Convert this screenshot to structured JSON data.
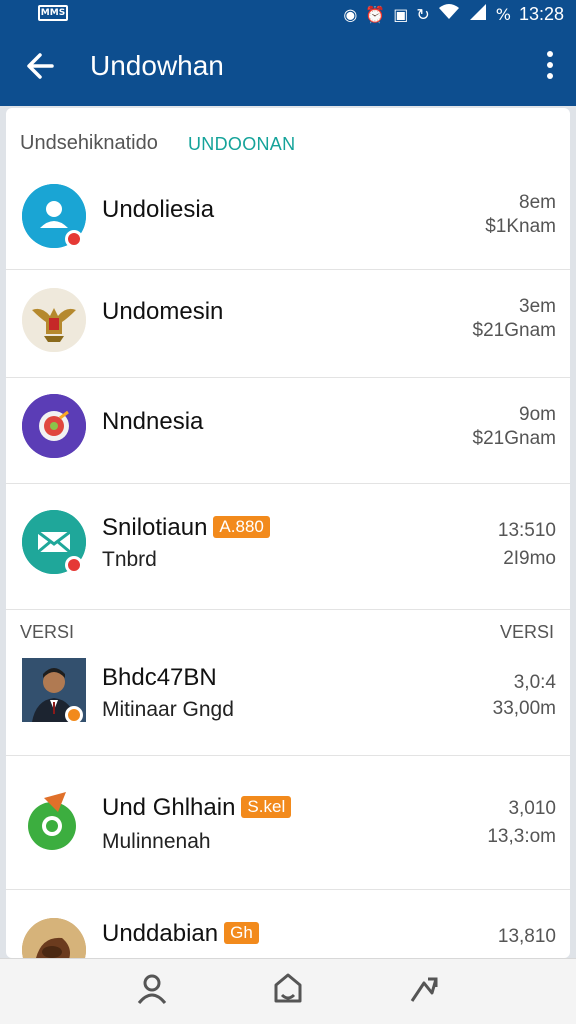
{
  "status_bar": {
    "left_icon_label": "MMS",
    "icons": [
      "opera-icon",
      "alarm-icon",
      "nfc-icon",
      "sync-icon",
      "wifi-icon",
      "signal-icon"
    ],
    "battery": "%",
    "time": "13:28"
  },
  "appbar": {
    "title": "Undowhan",
    "bg_color": "#0d4e8f"
  },
  "section1": {
    "label": "Undsehiknatido",
    "tab": "UNDOONAN"
  },
  "items1": [
    {
      "name": "Undoliesia",
      "tag": "",
      "sub": "",
      "meta1": "8em",
      "meta2": "$1Knam",
      "avatar": "person-icon"
    },
    {
      "name": "Undomesin",
      "tag": "",
      "sub": "",
      "meta1": "3em",
      "meta2": "$21Gnam",
      "avatar": "garuda-emblem-icon"
    },
    {
      "name": "Nndnesia",
      "tag": "",
      "sub": "",
      "meta1": "9om",
      "meta2": "$21Gnam",
      "avatar": "compass-icon"
    },
    {
      "name": "Snilotiaun",
      "tag": "A.880",
      "sub": "Tnbrd",
      "meta1": "13:510",
      "meta2": "2I9mo",
      "avatar": "mail-icon"
    }
  ],
  "section2": {
    "label": "VERSI",
    "right_label": "VERSI"
  },
  "items2": [
    {
      "name": "Bhdc47BN",
      "tag": "",
      "sub": "Mitinaar Gngd",
      "meta1": "3,0:4",
      "meta2": "33,00m",
      "avatar": "profile-photo"
    },
    {
      "name": "Und Ghlhain",
      "tag": "S.kel",
      "sub": "Mulinnenah",
      "meta1": "3,010",
      "meta2": "13,3:om",
      "avatar": "chat-bubble-icon"
    },
    {
      "name": "Unddabian",
      "tag": "Gh",
      "sub": "",
      "meta1": "13,810",
      "meta2": "",
      "avatar": "coconut-icon"
    }
  ],
  "bottom_nav": [
    "person-icon",
    "home-icon",
    "share-icon"
  ],
  "colors": {
    "accent": "#15a39a",
    "tag": "#f28a1c",
    "badge": "#e53935"
  }
}
